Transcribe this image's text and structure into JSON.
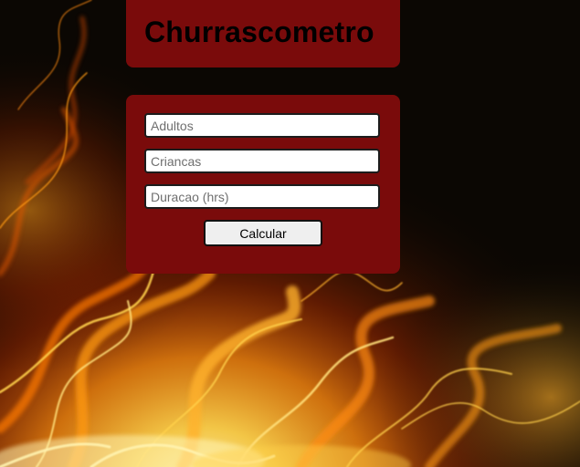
{
  "app": {
    "title": "Churrascometro"
  },
  "form": {
    "adults_placeholder": "Adultos",
    "adults_value": "",
    "children_placeholder": "Criancas",
    "children_value": "",
    "duration_placeholder": "Duracao (hrs)",
    "duration_value": "",
    "submit_label": "Calcular"
  },
  "colors": {
    "card_background": "#7a0b0b",
    "page_background": "#0b0703",
    "fire_core": "#fff3b0",
    "fire_mid": "#ffa21a",
    "fire_edge": "#d93a00"
  },
  "background": {
    "icon": "fire-flames-image"
  }
}
